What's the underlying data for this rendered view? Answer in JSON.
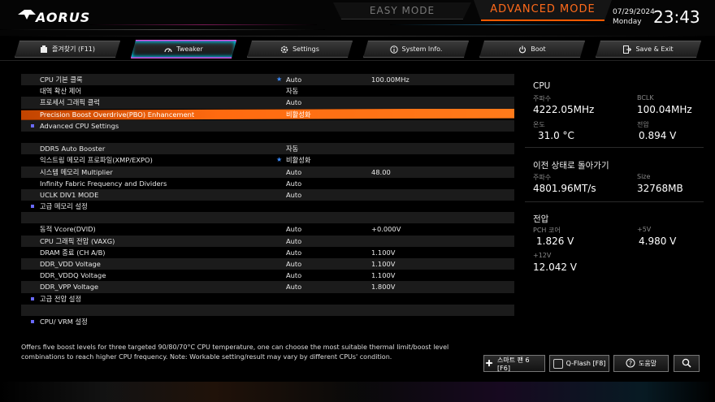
{
  "header": {
    "brand": "AORUS",
    "mode_easy": "EASY MODE",
    "mode_advanced": "ADVANCED MODE",
    "date": "07/29/2024",
    "weekday": "Monday",
    "time": "23:43"
  },
  "tabs": [
    {
      "label": "즐겨찾기 (F11)",
      "icon": "favorites-icon"
    },
    {
      "label": "Tweaker",
      "icon": "speedometer-icon",
      "active": true
    },
    {
      "label": "Settings",
      "icon": "gear-icon"
    },
    {
      "label": "System Info.",
      "icon": "info-icon"
    },
    {
      "label": "Boot",
      "icon": "power-icon"
    },
    {
      "label": "Save & Exit",
      "icon": "exit-icon"
    }
  ],
  "settings": [
    {
      "label": "CPU 기본 클록",
      "star": true,
      "value": "Auto",
      "extra": "100.00MHz"
    },
    {
      "label": "대역 확산 제어",
      "value": "자동"
    },
    {
      "label": "프로세서 그래픽 클럭",
      "value": "Auto"
    },
    {
      "label": "Precision Boost Overdrive(PBO) Enhancement",
      "value": "비활성화",
      "highlight": true
    },
    {
      "label": "Advanced CPU Settings",
      "submenu": true
    },
    {
      "label": ""
    },
    {
      "label": "DDR5 Auto Booster",
      "value": "자동"
    },
    {
      "label": "익스트림 메모리 프로파일(XMP/EXPO)",
      "star": true,
      "value": "비활성화"
    },
    {
      "label": "시스템 메모리 Multiplier",
      "value": "Auto",
      "extra": "48.00"
    },
    {
      "label": "Infinity Fabric Frequency and Dividers",
      "value": "Auto"
    },
    {
      "label": "UCLK DIV1 MODE",
      "value": "Auto"
    },
    {
      "label": "고급 메모리 설정",
      "submenu": true
    },
    {
      "label": ""
    },
    {
      "label": "동적 Vcore(DVID)",
      "value": "Auto",
      "extra": "+0.000V"
    },
    {
      "label": "CPU 그래픽 전압 (VAXG)",
      "value": "Auto"
    },
    {
      "label": "DRAM 종료 (CH A/B)",
      "value": "Auto",
      "extra": "1.100V"
    },
    {
      "label": "DDR_VDD Voltage",
      "value": "Auto",
      "extra": "1.100V"
    },
    {
      "label": "DDR_VDDQ Voltage",
      "value": "Auto",
      "extra": "1.100V"
    },
    {
      "label": "DDR_VPP Voltage",
      "value": "Auto",
      "extra": "1.800V"
    },
    {
      "label": "고급 전압 설정",
      "submenu": true
    },
    {
      "label": ""
    },
    {
      "label": "CPU/ VRM 설정",
      "submenu": true
    }
  ],
  "side": {
    "cpu": {
      "title": "CPU",
      "freq_label": "주파수",
      "freq": "4222.05MHz",
      "bclk_label": "BCLK",
      "bclk": "100.04MHz",
      "temp_label": "온도",
      "temp": "31.0 °C",
      "volt_label": "전압",
      "volt": "0.894 V"
    },
    "memory": {
      "title": "이전 상태로 돌아가기",
      "freq_label": "주파수",
      "freq": "4801.96MT/s",
      "size_label": "Size",
      "size": "32768MB"
    },
    "voltage": {
      "title": "전압",
      "pch_label": "PCH 코어",
      "pch": "1.826 V",
      "p5_label": "+5V",
      "p5": "4.980 V",
      "p12_label": "+12V",
      "p12": "12.042 V"
    }
  },
  "help": {
    "text": "Offers five boost levels for three targeted 90/80/70°C CPU temperature, one can choose the most suitable thermal limit/boost level combinations to reach higher CPU frequency. Note: Workable setting/result may vary by different CPUs' condition."
  },
  "footer": {
    "fan": "스마트 팬 6 [F6]",
    "qflash": "Q-Flash [F8]",
    "help": "도움말"
  },
  "colors": {
    "accent": "#ff6a1a",
    "highlight": "#ff6a10",
    "star": "#3b8cff"
  }
}
